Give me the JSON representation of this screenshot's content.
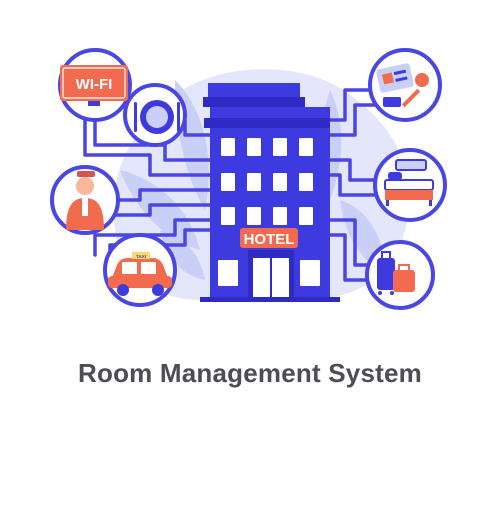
{
  "illustration": {
    "wifi_sign": "WI-FI",
    "hotel_sign": "HOTEL",
    "taxi_sign": "TAXI",
    "colors": {
      "primary": "#3d3ae0",
      "light_bg": "#dfe3fb",
      "accent": "#f26b4f",
      "white": "#ffffff"
    },
    "icons": [
      "wifi-icon",
      "dining-plate-icon",
      "bellboy-icon",
      "taxi-icon",
      "key-card-icon",
      "bedroom-icon",
      "luggage-icon"
    ]
  },
  "caption": "Room Management System"
}
